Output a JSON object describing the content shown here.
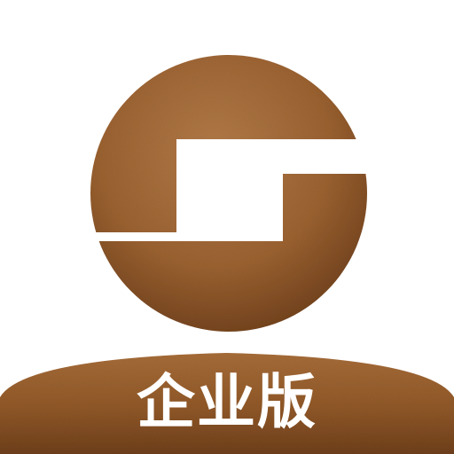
{
  "icon": {
    "semantic": "bank-logo-icon",
    "colors": {
      "background": "#ffffff",
      "bronze_light": "#b27a48",
      "bronze_mid": "#9a6130",
      "bronze_dark": "#6e3f1b",
      "mark": "#ffffff",
      "label_text": "#ffffff"
    }
  },
  "label": {
    "text": "企业版"
  }
}
